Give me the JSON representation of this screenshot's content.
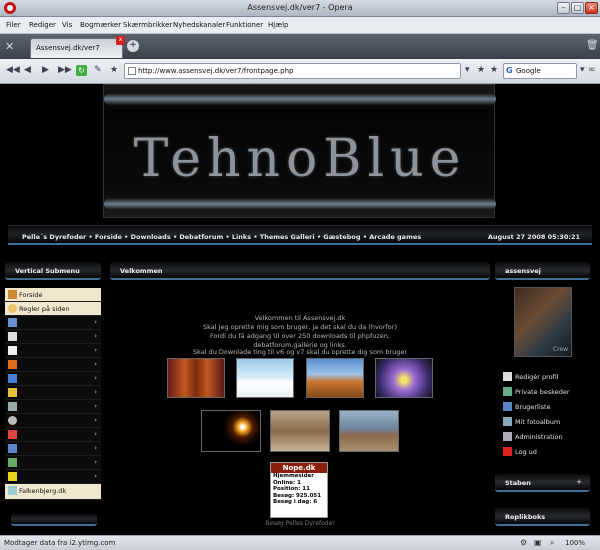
{
  "window": {
    "title": "Assensvej.dk/ver7 - Opera"
  },
  "menu": [
    "Filer",
    "Rediger",
    "Vis",
    "Bogmærker",
    "Skærmbrikker",
    "Nyhedskanaler",
    "Funktioner",
    "Hjælp"
  ],
  "tab": {
    "label": "Assensvej.dk/ver7"
  },
  "address": {
    "url": "http://www.assensvej.dk/ver7/frontpage.php",
    "search_placeholder": "Google"
  },
  "site": {
    "logo": "TehnoBlue",
    "nav_links": "Pelle´s Dyrefoder • Forside • Downloads • Debatforum • Links • Themes Galleri • Gæstebog • Arcade games",
    "date": "August 27 2008 05:30:21",
    "left_header": "Vertical Submenu",
    "center_header": "Velkommen",
    "right_header": "assensvej",
    "side_items": [
      "Forside",
      "Regler på siden",
      "",
      "",
      "",
      "",
      "",
      "",
      "",
      "",
      "",
      "",
      "",
      "",
      "Falkenbjerg.dk"
    ],
    "welcome_lines": [
      "Velkommen til Assensvej.dk",
      "Skal jeg oprette mig som bruger, ja det skal du da (hvorfor)",
      "Fordi du få adgang til over 250 downloads til phpfuzen,",
      "debatforum,gallerie og links."
    ],
    "download_text": "Skal du Downlade ting til v6 og v7 skal du oprette dig som bruger",
    "counter": {
      "title": "Nope.dk",
      "rows": [
        "Hjemmesider",
        "Online:  1",
        "Position:  11",
        "Besøg:  925.051",
        "Besøg i dag:  6"
      ]
    },
    "besog": "Besøg Pelles Dyrefoder",
    "user_links": [
      "Redigér profil",
      "Private beskeder",
      "Brugerliste",
      "Mit fotoalbum",
      "Administration",
      "Log ud"
    ],
    "staben": "Staben",
    "replikboks": "Replikboks",
    "avatar_caption": "Crew"
  },
  "status": {
    "message": "Modtager data fra i2.ytimg.com",
    "zoom": "100%"
  },
  "colors": {
    "accent": "#3e6f99",
    "page_bg": "#000000"
  }
}
